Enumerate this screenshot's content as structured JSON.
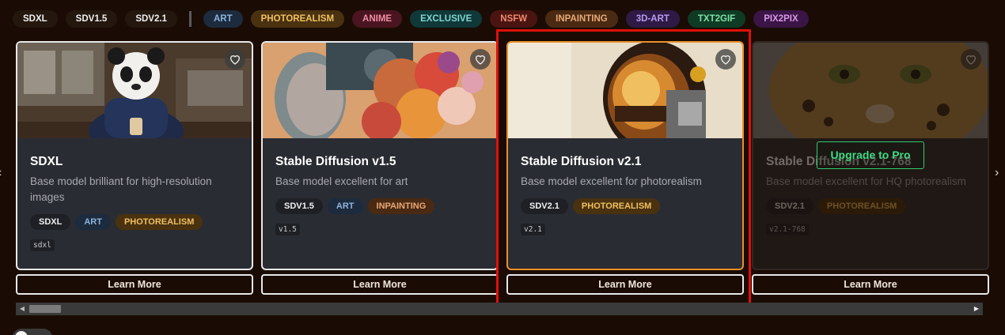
{
  "filters": {
    "base": [
      {
        "label": "SDXL",
        "name": "filter-sdxl"
      },
      {
        "label": "SDV1.5",
        "name": "filter-sdv15"
      },
      {
        "label": "SDV2.1",
        "name": "filter-sdv21"
      }
    ],
    "styles": [
      {
        "label": "ART",
        "name": "filter-art",
        "color": "#8fb3dc"
      },
      {
        "label": "PHOTOREALISM",
        "name": "filter-photorealism",
        "color": "#f0c060"
      },
      {
        "label": "ANIME",
        "name": "filter-anime",
        "color": "#ef8ea6"
      },
      {
        "label": "EXCLUSIVE",
        "name": "filter-exclusive",
        "color": "#7fd6d0"
      },
      {
        "label": "NSFW",
        "name": "filter-nsfw",
        "color": "#f08a70"
      },
      {
        "label": "INPAINTING",
        "name": "filter-inpainting",
        "color": "#e8a878"
      },
      {
        "label": "3D-ART",
        "name": "filter-3d-art",
        "color": "#b79af0"
      },
      {
        "label": "TXT2GIF",
        "name": "filter-txt2gif",
        "color": "#7ee0a8"
      },
      {
        "label": "PIX2PIX",
        "name": "filter-pix2pix",
        "color": "#d898e8"
      }
    ]
  },
  "cards": [
    {
      "title": "SDXL",
      "description": "Base model brilliant for high-resolution images",
      "tags": [
        "SDXL",
        "ART",
        "PHOTOREALISM"
      ],
      "code": "sdxl",
      "image": "panda-astronaut-in-cafe",
      "learn_more": "Learn More"
    },
    {
      "title": "Stable Diffusion v1.5",
      "description": "Base model excellent for art",
      "tags": [
        "SDV1.5",
        "ART",
        "INPAINTING"
      ],
      "code": "v1.5",
      "image": "woman-with-flower-headpiece",
      "learn_more": "Learn More"
    },
    {
      "title": "Stable Diffusion v2.1",
      "description": "Base model excellent for photorealism",
      "tags": [
        "SDV2.1",
        "PHOTOREALISM"
      ],
      "code": "v2.1",
      "image": "astronaut-helmet-reflection",
      "learn_more": "Learn More",
      "selected": true
    },
    {
      "title": "Stable Diffusion v2.1-768",
      "description": "Base model excellent for HQ photorealism",
      "tags": [
        "SDV2.1",
        "PHOTOREALISM"
      ],
      "code": "v2.1-768",
      "image": "leopard-face-in-snow",
      "learn_more": "Learn More",
      "locked": true,
      "upgrade_label": "Upgrade to Pro"
    }
  ],
  "icons": {
    "favorite": "heart-icon",
    "prev": "chevron-left-icon",
    "next": "chevron-right-icon"
  },
  "colors": {
    "background": "#1a0c04",
    "card": "#2a2c33",
    "selected_border": "#e8902a",
    "highlight": "#e0100a",
    "upgrade": "#3ddc84"
  }
}
